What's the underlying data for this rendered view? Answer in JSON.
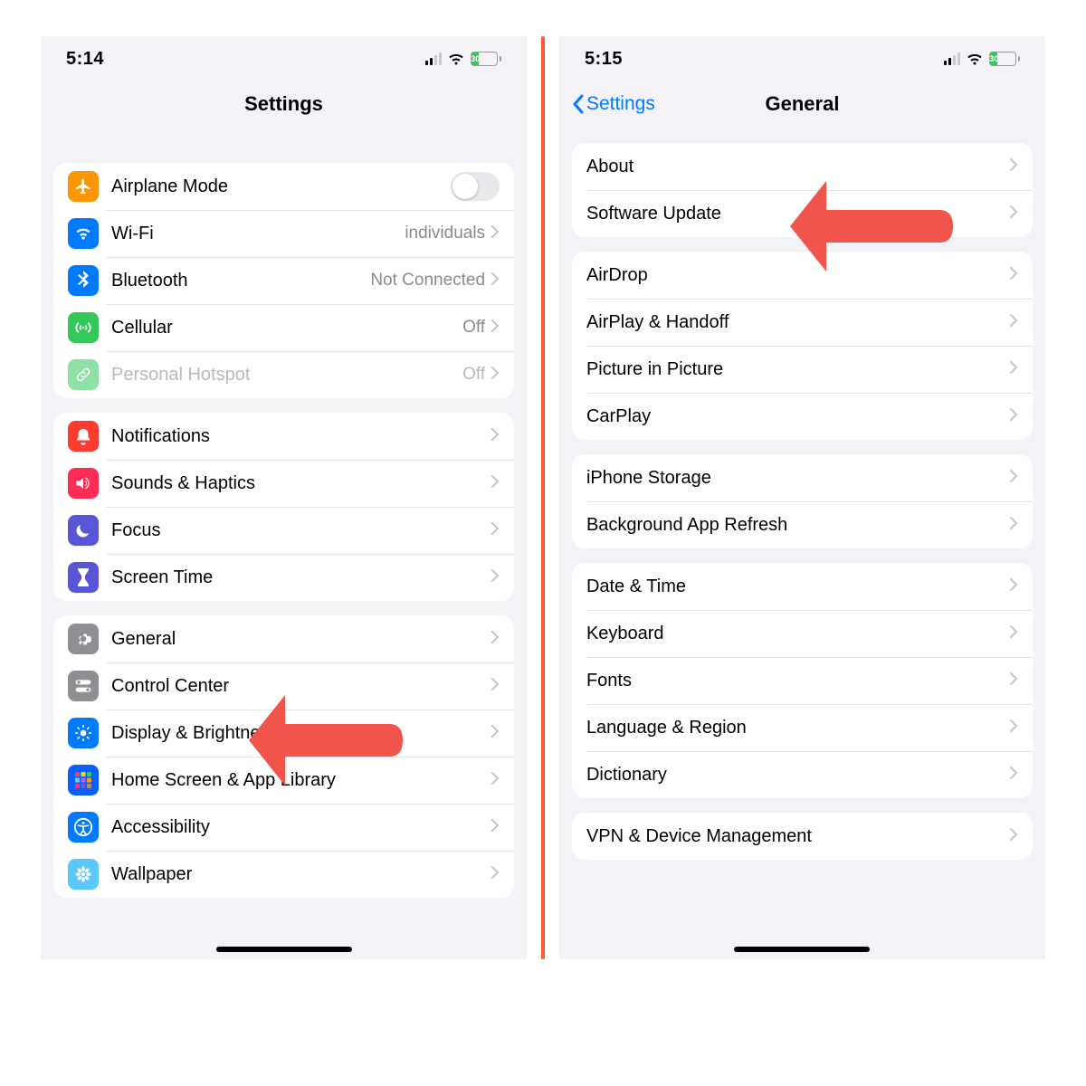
{
  "left": {
    "status": {
      "time": "5:14",
      "battery": "30"
    },
    "header": {
      "title": "Settings"
    },
    "groups": [
      {
        "rows": [
          {
            "name": "airplane-mode",
            "icon": "airplane-icon",
            "icon_bg": "bg-orange",
            "label": "Airplane Mode",
            "toggle": true
          },
          {
            "name": "wifi",
            "icon": "wifi-icon",
            "icon_bg": "bg-blue",
            "label": "Wi-Fi",
            "value": "individuals",
            "chevron": true
          },
          {
            "name": "bluetooth",
            "icon": "bluetooth-icon",
            "icon_bg": "bg-blue",
            "label": "Bluetooth",
            "value": "Not Connected",
            "chevron": true
          },
          {
            "name": "cellular",
            "icon": "cellular-icon",
            "icon_bg": "bg-green",
            "label": "Cellular",
            "value": "Off",
            "chevron": true
          },
          {
            "name": "personal-hotspot",
            "icon": "link-icon",
            "icon_bg": "bg-green",
            "label": "Personal Hotspot",
            "value": "Off",
            "chevron": true,
            "dim": true
          }
        ]
      },
      {
        "rows": [
          {
            "name": "notifications",
            "icon": "bell-icon",
            "icon_bg": "bg-red",
            "label": "Notifications",
            "chevron": true
          },
          {
            "name": "sounds-haptics",
            "icon": "speaker-icon",
            "icon_bg": "bg-pink",
            "label": "Sounds & Haptics",
            "chevron": true
          },
          {
            "name": "focus",
            "icon": "moon-icon",
            "icon_bg": "bg-indigo",
            "label": "Focus",
            "chevron": true
          },
          {
            "name": "screen-time",
            "icon": "hourglass-icon",
            "icon_bg": "bg-indigo",
            "label": "Screen Time",
            "chevron": true
          }
        ]
      },
      {
        "rows": [
          {
            "name": "general",
            "icon": "gear-icon",
            "icon_bg": "bg-gray",
            "label": "General",
            "chevron": true
          },
          {
            "name": "control-center",
            "icon": "switches-icon",
            "icon_bg": "bg-gray",
            "label": "Control Center",
            "chevron": true
          },
          {
            "name": "display-brightness",
            "icon": "sun-icon",
            "icon_bg": "bg-blue",
            "label": "Display & Brightness",
            "chevron": true
          },
          {
            "name": "home-screen-app-library",
            "icon": "grid-icon",
            "icon_bg": "bg-darkblue",
            "label": "Home Screen & App Library",
            "chevron": true
          },
          {
            "name": "accessibility",
            "icon": "accessibility-icon",
            "icon_bg": "bg-blue",
            "label": "Accessibility",
            "chevron": true
          },
          {
            "name": "wallpaper",
            "icon": "flower-icon",
            "icon_bg": "bg-teal",
            "label": "Wallpaper",
            "chevron": true
          }
        ]
      }
    ]
  },
  "right": {
    "status": {
      "time": "5:15",
      "battery": "30"
    },
    "header": {
      "back": "Settings",
      "title": "General"
    },
    "groups": [
      {
        "rows": [
          {
            "name": "about",
            "label": "About",
            "chevron": true
          },
          {
            "name": "software-update",
            "label": "Software Update",
            "chevron": true
          }
        ]
      },
      {
        "rows": [
          {
            "name": "airdrop",
            "label": "AirDrop",
            "chevron": true
          },
          {
            "name": "airplay-handoff",
            "label": "AirPlay & Handoff",
            "chevron": true
          },
          {
            "name": "picture-in-picture",
            "label": "Picture in Picture",
            "chevron": true
          },
          {
            "name": "carplay",
            "label": "CarPlay",
            "chevron": true
          }
        ]
      },
      {
        "rows": [
          {
            "name": "iphone-storage",
            "label": "iPhone Storage",
            "chevron": true
          },
          {
            "name": "background-app-refresh",
            "label": "Background App Refresh",
            "chevron": true
          }
        ]
      },
      {
        "rows": [
          {
            "name": "date-time",
            "label": "Date & Time",
            "chevron": true
          },
          {
            "name": "keyboard",
            "label": "Keyboard",
            "chevron": true
          },
          {
            "name": "fonts",
            "label": "Fonts",
            "chevron": true
          },
          {
            "name": "language-region",
            "label": "Language & Region",
            "chevron": true
          },
          {
            "name": "dictionary",
            "label": "Dictionary",
            "chevron": true
          }
        ]
      },
      {
        "rows": [
          {
            "name": "vpn-device-management",
            "label": "VPN & Device Management",
            "chevron": true
          }
        ]
      }
    ]
  }
}
